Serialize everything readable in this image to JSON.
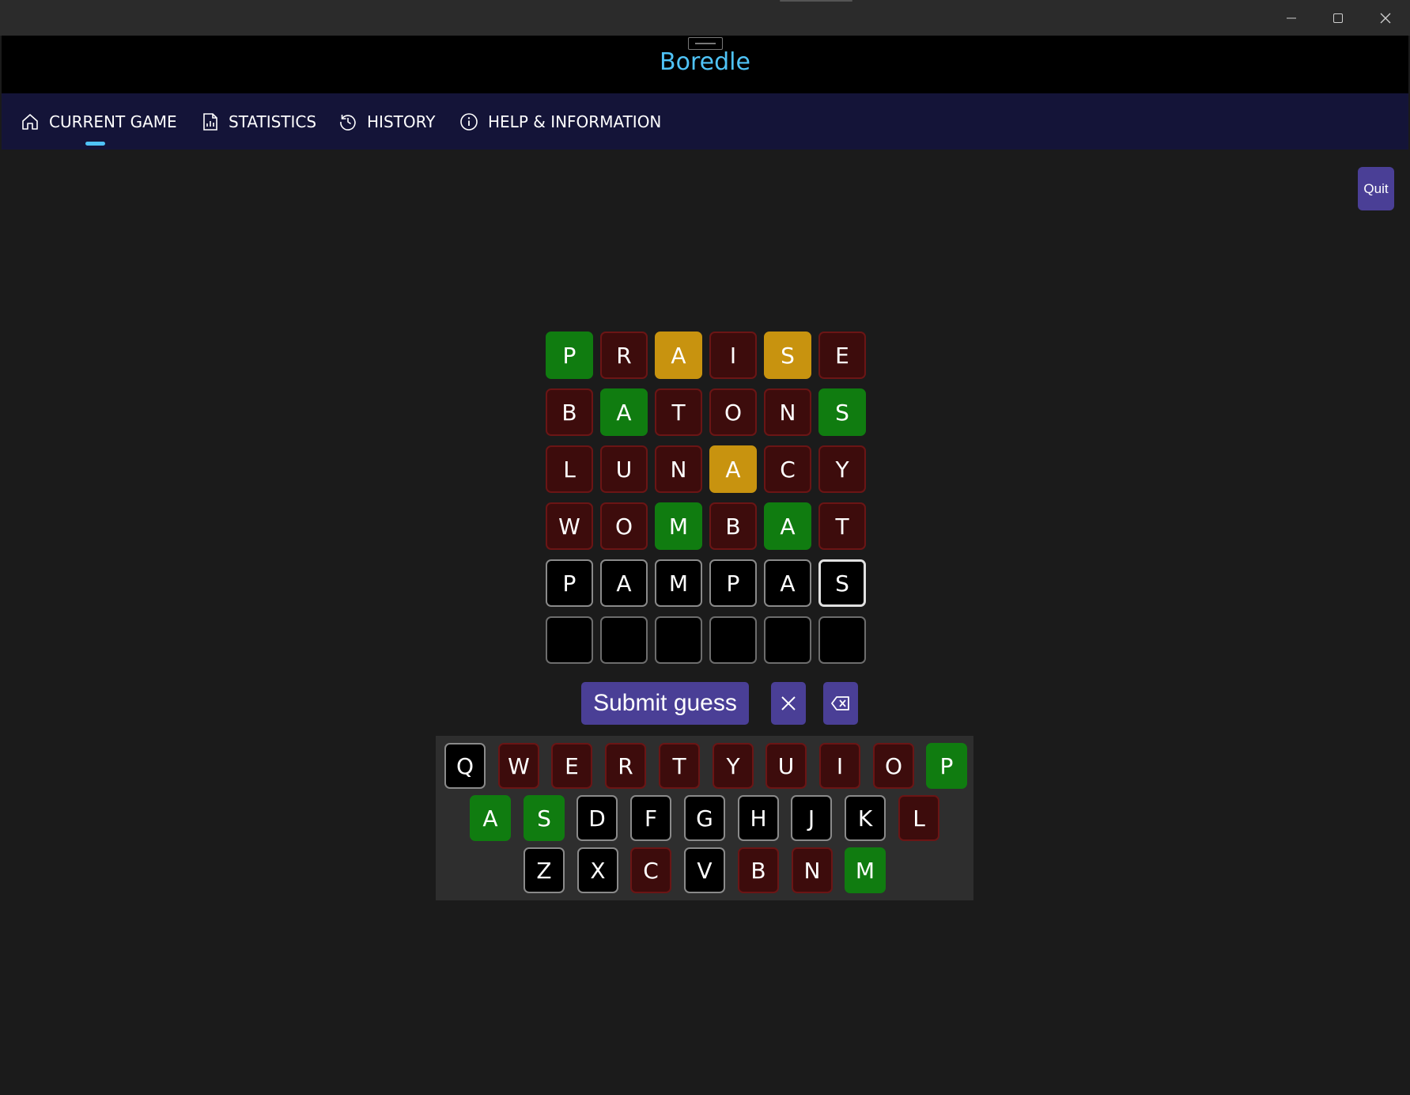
{
  "app": {
    "title": "Boredle"
  },
  "nav": {
    "tabs": [
      {
        "label": "CURRENT GAME",
        "icon": "home-icon",
        "active": true
      },
      {
        "label": "STATISTICS",
        "icon": "report-icon"
      },
      {
        "label": "HISTORY",
        "icon": "history-icon"
      },
      {
        "label": "HELP & INFORMATION",
        "icon": "info-icon"
      }
    ]
  },
  "actions": {
    "quit_label": "Quit",
    "submit_label": "Submit guess"
  },
  "colors": {
    "accent": "#4fc3f7",
    "button": "#4a3f96",
    "correct": "#107c10",
    "present": "#c8930f",
    "absent": "#3d0c0c"
  },
  "board": {
    "rows": [
      {
        "letters": [
          "P",
          "R",
          "A",
          "I",
          "S",
          "E"
        ],
        "states": [
          "correct",
          "absent",
          "present",
          "absent",
          "present",
          "absent"
        ]
      },
      {
        "letters": [
          "B",
          "A",
          "T",
          "O",
          "N",
          "S"
        ],
        "states": [
          "absent",
          "correct",
          "absent",
          "absent",
          "absent",
          "correct"
        ]
      },
      {
        "letters": [
          "L",
          "U",
          "N",
          "A",
          "C",
          "Y"
        ],
        "states": [
          "absent",
          "absent",
          "absent",
          "present",
          "absent",
          "absent"
        ]
      },
      {
        "letters": [
          "W",
          "O",
          "M",
          "B",
          "A",
          "T"
        ],
        "states": [
          "absent",
          "absent",
          "correct",
          "absent",
          "correct",
          "absent"
        ]
      },
      {
        "letters": [
          "P",
          "A",
          "M",
          "P",
          "A",
          "S"
        ],
        "states": [
          "typed",
          "typed",
          "typed",
          "typed",
          "typed",
          "typed-active"
        ]
      },
      {
        "letters": [
          "",
          "",
          "",
          "",
          "",
          ""
        ],
        "states": [
          "empty",
          "empty",
          "empty",
          "empty",
          "empty",
          "empty"
        ]
      }
    ]
  },
  "keyboard": {
    "rows": [
      {
        "keys": [
          [
            "Q",
            "unused"
          ],
          [
            "W",
            "absent"
          ],
          [
            "E",
            "absent"
          ],
          [
            "R",
            "absent"
          ],
          [
            "T",
            "absent"
          ],
          [
            "Y",
            "absent"
          ],
          [
            "U",
            "absent"
          ],
          [
            "I",
            "absent"
          ],
          [
            "O",
            "absent"
          ],
          [
            "P",
            "correct"
          ]
        ]
      },
      {
        "keys": [
          [
            "A",
            "correct"
          ],
          [
            "S",
            "correct"
          ],
          [
            "D",
            "unused"
          ],
          [
            "F",
            "unused"
          ],
          [
            "G",
            "unused"
          ],
          [
            "H",
            "unused"
          ],
          [
            "J",
            "unused"
          ],
          [
            "K",
            "unused"
          ],
          [
            "L",
            "absent"
          ]
        ]
      },
      {
        "keys": [
          [
            "Z",
            "unused"
          ],
          [
            "X",
            "unused"
          ],
          [
            "C",
            "absent"
          ],
          [
            "V",
            "unused"
          ],
          [
            "B",
            "absent"
          ],
          [
            "N",
            "absent"
          ],
          [
            "M",
            "correct"
          ]
        ]
      }
    ]
  }
}
